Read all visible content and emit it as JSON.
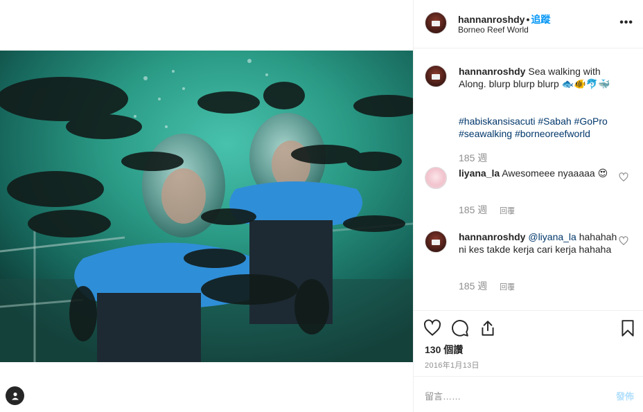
{
  "post": {
    "username": "hannanroshdy",
    "follow_label": "追蹤",
    "location": "Borneo Reef World",
    "more_icon": "more-options-icon"
  },
  "caption": {
    "username": "hannanroshdy",
    "text": "Sea walking with Along. blurp blurp blurp 🐟🐠🐬🐳",
    "hashtags": "#habiskansisacuti #Sabah #GoPro #seawalking #borneoreefworld",
    "age": "185 週"
  },
  "comments": [
    {
      "username": "liyana_la",
      "text": "Awesomeee nyaaaaa 😍",
      "age": "185 週",
      "reply": "回覆"
    },
    {
      "username": "hannanroshdy",
      "mention": "@liyana_la",
      "text": "hahahah ni kes takde kerja cari kerja hahaha",
      "age": "185 週",
      "reply": "回覆"
    }
  ],
  "actions": {
    "likes": "130 個讚",
    "date": "2016年1月13日"
  },
  "comment_box": {
    "placeholder": "留言……",
    "post_label": "發佈"
  },
  "colors": {
    "link_blue": "#0095f6",
    "hashtag": "#00376b",
    "muted": "#8e8e8e",
    "post_disabled": "#b2dffc",
    "water": "#1f8a78"
  }
}
